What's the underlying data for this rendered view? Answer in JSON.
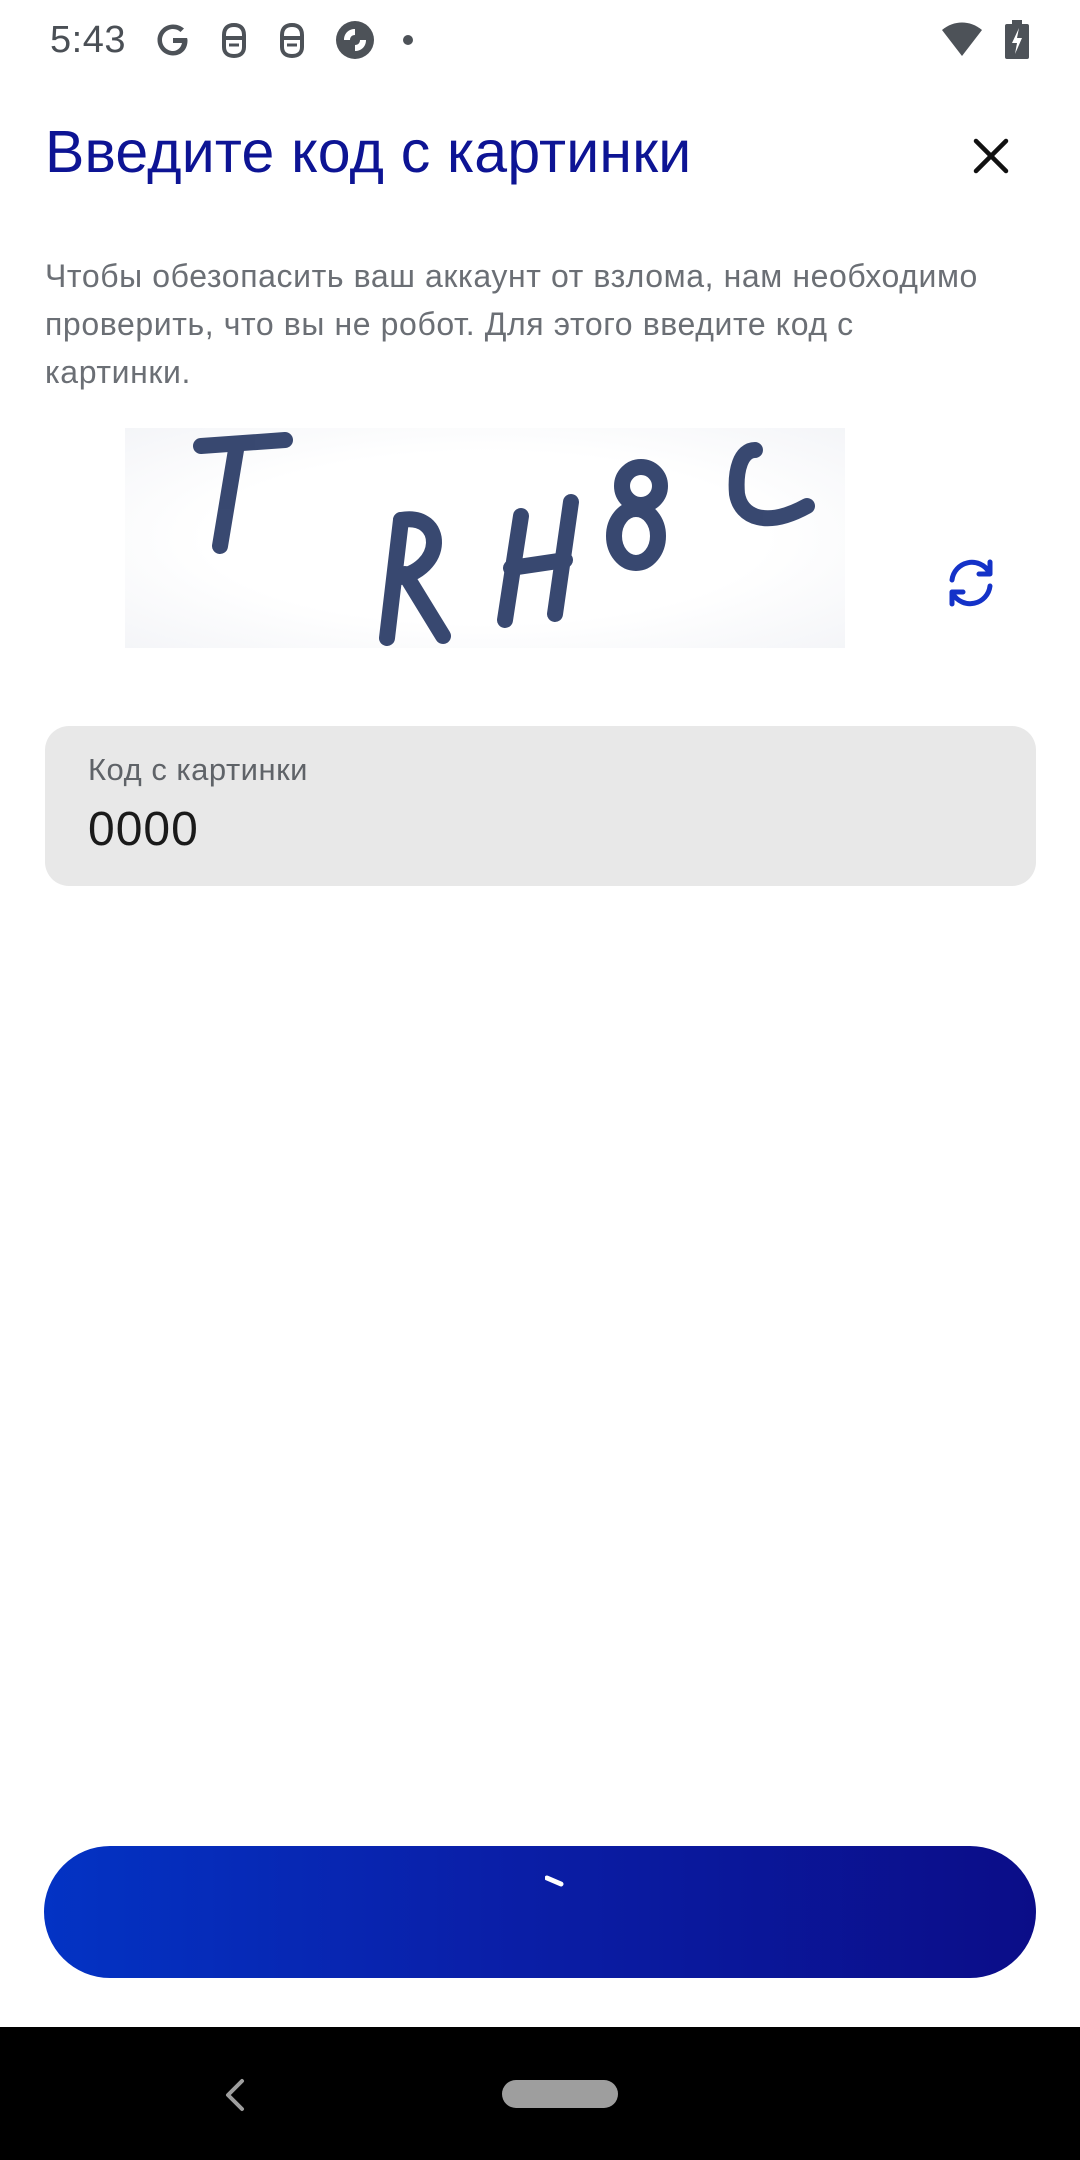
{
  "status_bar": {
    "time": "5:43",
    "icons": [
      "google-icon",
      "notification-app-icon",
      "notification-app-icon",
      "app-circle-icon",
      "dot-icon",
      "wifi-icon",
      "battery-charging-icon"
    ]
  },
  "dialog": {
    "title": "Введите код с картинки",
    "description": "Чтобы обезопасить ваш аккаунт от взлома, нам необходимо проверить, что вы не робот. Для этого введите код с картинки."
  },
  "captcha": {
    "text": "TRH8C",
    "refresh_icon": "refresh-icon"
  },
  "code_field": {
    "label": "Код с картинки",
    "value": "0000"
  },
  "submit": {
    "state": "loading"
  },
  "colors": {
    "title": "#0d1494",
    "accent": "#1432c8",
    "button_start": "#0333c4",
    "button_end": "#0b0d88",
    "field_bg": "#e8e8e8"
  }
}
